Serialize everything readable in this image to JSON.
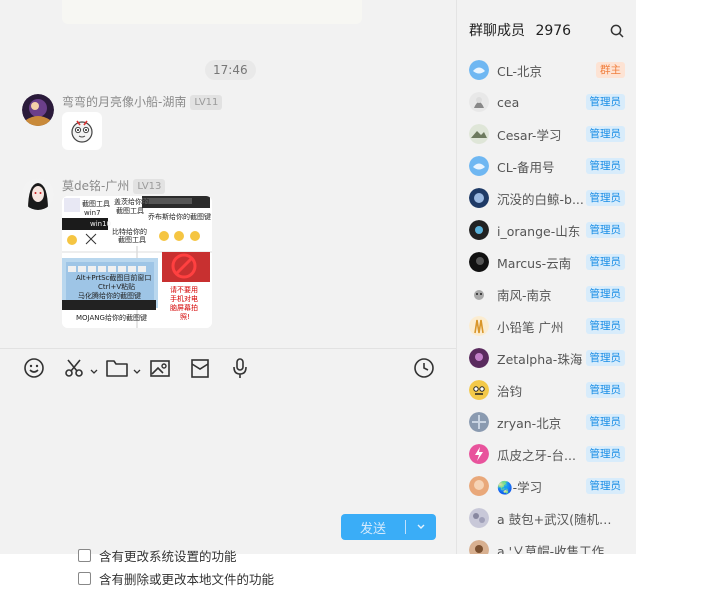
{
  "chat": {
    "time_divider": "17:46",
    "messages": [
      {
        "sender": "弯弯的月亮像小船-湖南",
        "level": "LV11"
      },
      {
        "sender": "莫de铭-广州",
        "level": "LV13"
      }
    ],
    "meme_texts": [
      "截图工具",
      "win7",
      "盖茨给你的",
      "截图工具",
      "win10",
      "比特给你的",
      "截图工具",
      "乔布斯给你的截图键",
      "Alt+PrtSc截图目前窗口",
      "Ctrl+V粘贴",
      "马化腾给你的截图键",
      "MOJANG给你的截图键",
      "请不要用",
      "手机对电",
      "脑屏幕拍",
      "照!"
    ]
  },
  "toolbar": {
    "icons": [
      "emoji-icon",
      "scissors-icon",
      "folder-icon",
      "image-icon",
      "red-packet-icon",
      "microphone-icon",
      "history-icon"
    ]
  },
  "composer": {
    "send_label": "发送",
    "placeholder": ""
  },
  "members": {
    "title": "群聊成员",
    "count": "2976",
    "list": [
      {
        "name": "CL-北京",
        "role": "群主"
      },
      {
        "name": "cea",
        "role": "管理员"
      },
      {
        "name": "Cesar-学习",
        "role": "管理员"
      },
      {
        "name": "CL-备用号",
        "role": "管理员"
      },
      {
        "name": "沉没的白鲸-b...",
        "role": "管理员"
      },
      {
        "name": "i_orange-山东",
        "role": "管理员"
      },
      {
        "name": "Marcus-云南",
        "role": "管理员"
      },
      {
        "name": "南风-南京",
        "role": "管理员"
      },
      {
        "name": "小铅笔 广州",
        "role": "管理员"
      },
      {
        "name": "Zetalpha-珠海",
        "role": "管理员"
      },
      {
        "name": "治钧",
        "role": "管理员"
      },
      {
        "name": "zryan-北京",
        "role": "管理员"
      },
      {
        "name": "瓜皮之牙-台...",
        "role": "管理员"
      },
      {
        "name": "🌏-学习",
        "role": "管理员"
      },
      {
        "name": "a 鼓包+武汉(随机指...",
        "role": ""
      },
      {
        "name": "a '乂草帽-收售工作...",
        "role": ""
      }
    ]
  },
  "background_options": [
    "含有更改系统设置的功能",
    "含有删除或更改本地文件的功能"
  ],
  "colors": {
    "accent": "#1aa1f8",
    "admin_badge": "#1a8ee6",
    "owner_badge": "#f08040"
  }
}
